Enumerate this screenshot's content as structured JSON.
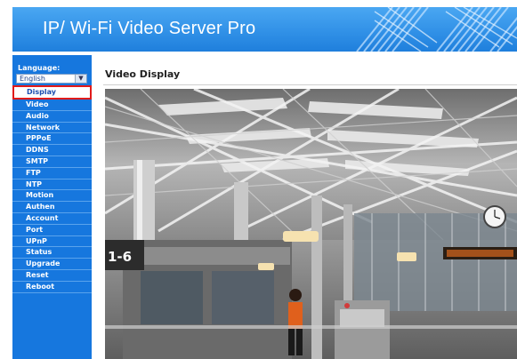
{
  "header": {
    "title": "IP/ Wi-Fi Video Server Pro",
    "bg_color": "#2f8fe6"
  },
  "sidebar": {
    "language_label": "Language:",
    "language_value": "English",
    "bg_color": "#1677de",
    "items": [
      {
        "label": "Display",
        "active": true
      },
      {
        "label": "Video"
      },
      {
        "label": "Audio"
      },
      {
        "label": "Network"
      },
      {
        "label": "PPPoE"
      },
      {
        "label": "DDNS"
      },
      {
        "label": "SMTP"
      },
      {
        "label": "FTP"
      },
      {
        "label": "NTP"
      },
      {
        "label": "Motion"
      },
      {
        "label": "Authen"
      },
      {
        "label": "Account"
      },
      {
        "label": "Port"
      },
      {
        "label": "UPnP"
      },
      {
        "label": "Status"
      },
      {
        "label": "Upgrade"
      },
      {
        "label": "Reset"
      },
      {
        "label": "Reboot"
      }
    ]
  },
  "main": {
    "title": "Video Display",
    "video": {
      "description_icon": "camera-feed-icon",
      "sign_text": "1-6"
    }
  }
}
